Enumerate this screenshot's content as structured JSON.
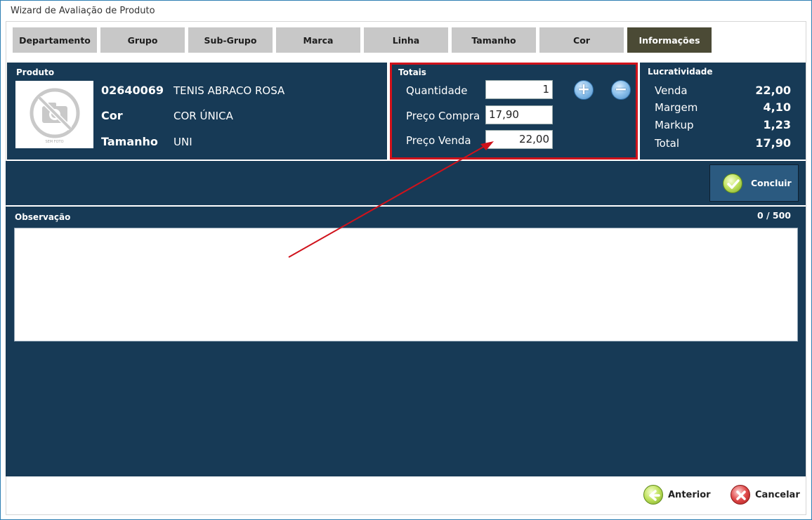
{
  "window": {
    "title": "Wizard de Avaliação de Produto"
  },
  "tabs": [
    {
      "label": "Departamento",
      "active": false
    },
    {
      "label": "Grupo",
      "active": false
    },
    {
      "label": "Sub-Grupo",
      "active": false
    },
    {
      "label": "Marca",
      "active": false
    },
    {
      "label": "Linha",
      "active": false
    },
    {
      "label": "Tamanho",
      "active": false
    },
    {
      "label": "Cor",
      "active": false
    },
    {
      "label": "Informações",
      "active": true
    }
  ],
  "produto": {
    "title": "Produto",
    "photo_caption": "SEM FOTO",
    "code": "02640069",
    "name": "TENIS ABRACO ROSA",
    "cor_label": "Cor",
    "cor_value": "COR ÚNICA",
    "tamanho_label": "Tamanho",
    "tamanho_value": "UNI"
  },
  "totais": {
    "title": "Totais",
    "quantidade_label": "Quantidade",
    "quantidade_value": "1",
    "preco_compra_label": "Preço Compra",
    "preco_compra_value": "17,90",
    "preco_venda_label": "Preço Venda",
    "preco_venda_value": "22,00",
    "plus_icon": "plus-circle-icon",
    "minus_icon": "minus-circle-icon"
  },
  "lucratividade": {
    "title": "Lucratividade",
    "rows": [
      {
        "label": "Venda",
        "value": "22,00"
      },
      {
        "label": "Margem",
        "value": "4,10"
      },
      {
        "label": "Markup",
        "value": "1,23"
      },
      {
        "label": "Total",
        "value": "17,90"
      }
    ]
  },
  "concluir": {
    "label": "Concluir",
    "icon": "check-circle-icon"
  },
  "observacao": {
    "title": "Observação",
    "counter": "0 / 500",
    "value": ""
  },
  "footer": {
    "anterior_label": "Anterior",
    "cancelar_label": "Cancelar"
  },
  "colors": {
    "panel": "#173a56",
    "tab": "#c8c8c8",
    "tab_active": "#4b4a35",
    "highlight": "#d0121b"
  }
}
